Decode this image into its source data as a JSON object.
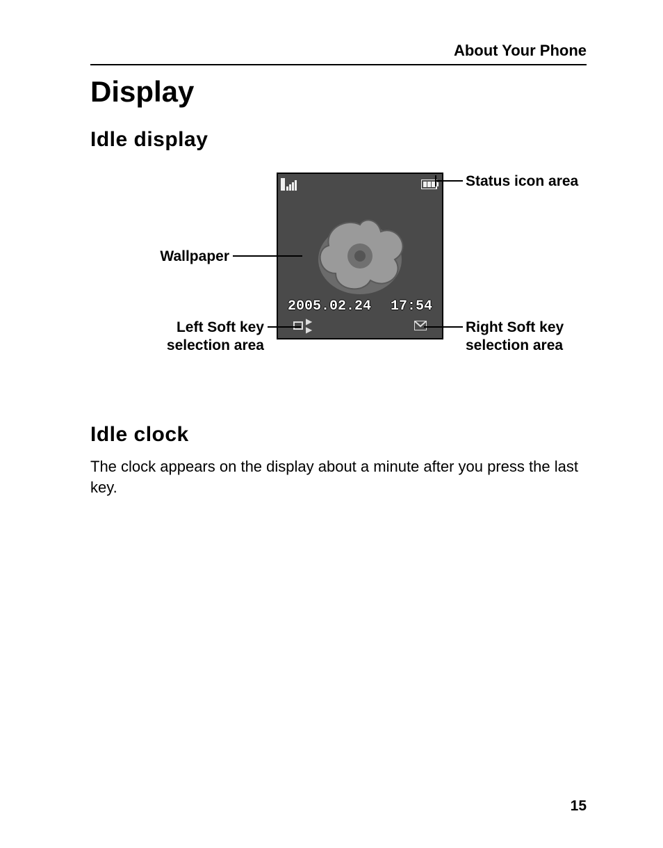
{
  "header": {
    "section": "About Your Phone"
  },
  "h1": "Display",
  "section1": {
    "heading": "Idle display"
  },
  "diagram": {
    "labels": {
      "status": "Status icon area",
      "wallpaper": "Wallpaper",
      "leftSoft1": "Left Soft key",
      "leftSoft2": "selection area",
      "rightSoft1": "Right Soft key",
      "rightSoft2": "selection area"
    },
    "screen": {
      "date": "2005.02.24",
      "time": "17:54"
    }
  },
  "section2": {
    "heading": "Idle clock",
    "body": "The clock appears on the display about a minute after you press the last key."
  },
  "pageNumber": "15"
}
